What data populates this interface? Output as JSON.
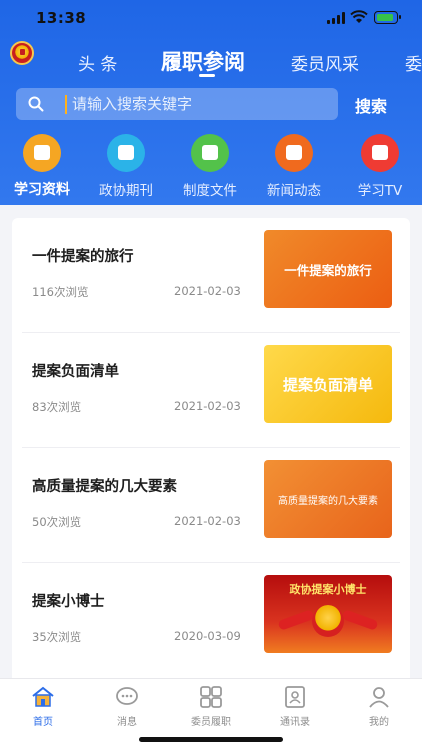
{
  "status_bar": {
    "time": "13:38"
  },
  "tabs": [
    {
      "label": "头 条",
      "active": false
    },
    {
      "label": "履职参阅",
      "active": true
    },
    {
      "label": "委员风采",
      "active": false
    },
    {
      "label": "委",
      "active": false
    }
  ],
  "search": {
    "placeholder": "请输入搜索关键字",
    "button_label": "搜索"
  },
  "categories": [
    {
      "label": "学习资料",
      "color": "#f5a623",
      "active": true,
      "icon": "folder-icon"
    },
    {
      "label": "政协期刊",
      "color": "#2bb3e8",
      "active": false,
      "icon": "books-icon"
    },
    {
      "label": "制度文件",
      "color": "#53c24a",
      "active": false,
      "icon": "document-icon"
    },
    {
      "label": "新闻动态",
      "color": "#f06a1e",
      "active": false,
      "icon": "newspaper-icon"
    },
    {
      "label": "学习TV",
      "color": "#ef3b33",
      "active": false,
      "icon": "tv-icon"
    }
  ],
  "articles": [
    {
      "title": "一件提案的旅行",
      "views": "116次浏览",
      "date": "2021-02-03",
      "thumb_text": "一件提案的旅行"
    },
    {
      "title": "提案负面清单",
      "views": "83次浏览",
      "date": "2021-02-03",
      "thumb_text": "提案负面清单"
    },
    {
      "title": "高质量提案的几大要素",
      "views": "50次浏览",
      "date": "2021-02-03",
      "thumb_text": "高质量提案的几大要素"
    },
    {
      "title": "提案小博士",
      "views": "35次浏览",
      "date": "2020-03-09",
      "thumb_text": "政协提案小博士"
    }
  ],
  "bottom_nav": [
    {
      "label": "首页",
      "active": true,
      "icon": "home-icon"
    },
    {
      "label": "消息",
      "active": false,
      "icon": "message-icon"
    },
    {
      "label": "委员履职",
      "active": false,
      "icon": "grid-icon"
    },
    {
      "label": "通讯录",
      "active": false,
      "icon": "contacts-icon"
    },
    {
      "label": "我的",
      "active": false,
      "icon": "profile-icon"
    }
  ],
  "colors": {
    "header_blue": "#1f66e6",
    "accent_orange": "#ffb21b",
    "nav_active": "#2c6de8"
  }
}
